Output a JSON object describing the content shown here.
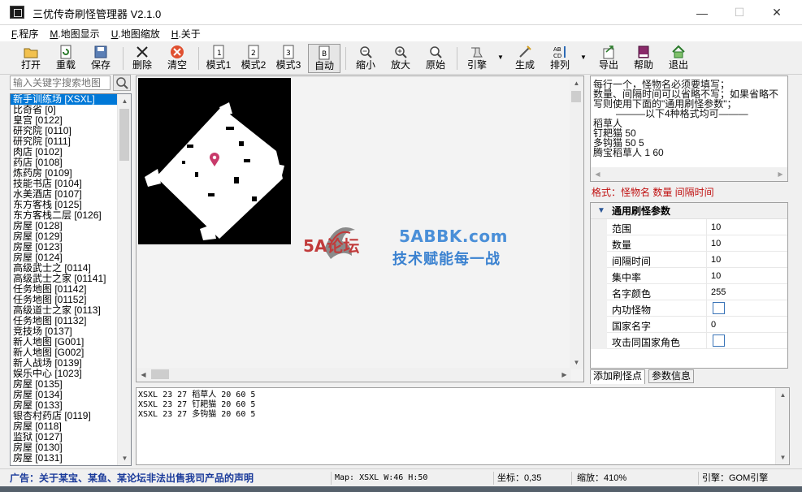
{
  "window": {
    "title": "三优传奇刷怪管理器 V2.1.0",
    "min": "—",
    "max": "☐",
    "close": "✕"
  },
  "menu": [
    {
      "key": "F",
      "label": ".程序"
    },
    {
      "key": "M",
      "label": ".地图显示"
    },
    {
      "key": "U",
      "label": ".地图缩放"
    },
    {
      "key": "H",
      "label": ".关于"
    }
  ],
  "toolbar": {
    "open": "打开",
    "reload": "重载",
    "save": "保存",
    "delete": "删除",
    "clear": "清空",
    "mode1": "模式1",
    "mode2": "模式2",
    "mode3": "模式3",
    "auto": "自动",
    "zoom_out": "缩小",
    "zoom_in": "放大",
    "original": "原始",
    "engine": "引擎",
    "generate": "生成",
    "sort": "排列",
    "export": "导出",
    "help": "帮助",
    "exit": "退出"
  },
  "search": {
    "placeholder": "输入关键字搜索地图"
  },
  "map_list": [
    "新手训练场 [XSXL]",
    "比奇省 [0]",
    "皇宫 [0122]",
    "研究院 [0110]",
    "研究院 [0111]",
    "肉店 [0102]",
    "药店 [0108]",
    "炼药房 [0109]",
    "技能书店 [0104]",
    "水美酒店 [0107]",
    "东方客栈 [0125]",
    "东方客栈二层 [0126]",
    "房屋 [0128]",
    "房屋 [0129]",
    "房屋 [0123]",
    "房屋 [0124]",
    "高级武士之 [0114]",
    "高级武士之家 [01141]",
    "任务地图 [01142]",
    "任务地图 [01152]",
    "高级道士之家 [0113]",
    "任务地图 [01132]",
    "竞技场 [0137]",
    "新人地图 [G001]",
    "新人地图 [G002]",
    "新人战场 [0139]",
    "娱乐中心 [1023]",
    "房屋 [0135]",
    "房屋 [0134]",
    "房屋 [0133]",
    "银杏村药店 [0119]",
    "房屋 [0118]",
    "监狱 [0127]",
    "房屋 [0130]",
    "房屋 [0131]"
  ],
  "watermark": {
    "logo": "5A论坛",
    "site": "5ABBK.com",
    "slogan": "技术赋能每一战"
  },
  "notes": [
    "每行一个，怪物名必须要填写；",
    "数量、间隔时间可以省略不写；如果省略不",
    "写则使用下面的\"通用刷怪参数\"；",
    "———以下4种格式均可———",
    "稻草人",
    "钉耙猫 50",
    "多钩猫 50 5",
    "腾宝稻草人 1 60"
  ],
  "format_hint": "格式：怪物名   数量   间隔时间",
  "params": {
    "title": "通用刷怪参数",
    "rows": [
      {
        "name": "范围",
        "value": "10"
      },
      {
        "name": "数量",
        "value": "10"
      },
      {
        "name": "间隔时间",
        "value": "10"
      },
      {
        "name": "集中率",
        "value": "10"
      },
      {
        "name": "名字颜色",
        "value": "255"
      },
      {
        "name": "内功怪物",
        "value": ""
      },
      {
        "name": "国家名字",
        "value": "0"
      },
      {
        "name": "攻击同国家角色",
        "value": ""
      }
    ]
  },
  "tabs": {
    "add_spawn": "添加刷怪点",
    "params_info": "参数信息"
  },
  "output_lines": [
    "XSXL 23 27 稻草人 20 60 5",
    "XSXL 23 27 钉耙猫 20 60 5",
    "XSXL 23 27 多钩猫 20 60 5"
  ],
  "status": {
    "ad": "广告：关于某宝、某鱼、某论坛非法出售我司产品的声明",
    "map": "Map: XSXL  W:46 H:50",
    "coord": "坐标：0,35",
    "zoom": "缩放：410%",
    "engine": "引擎：GOM引擎"
  }
}
